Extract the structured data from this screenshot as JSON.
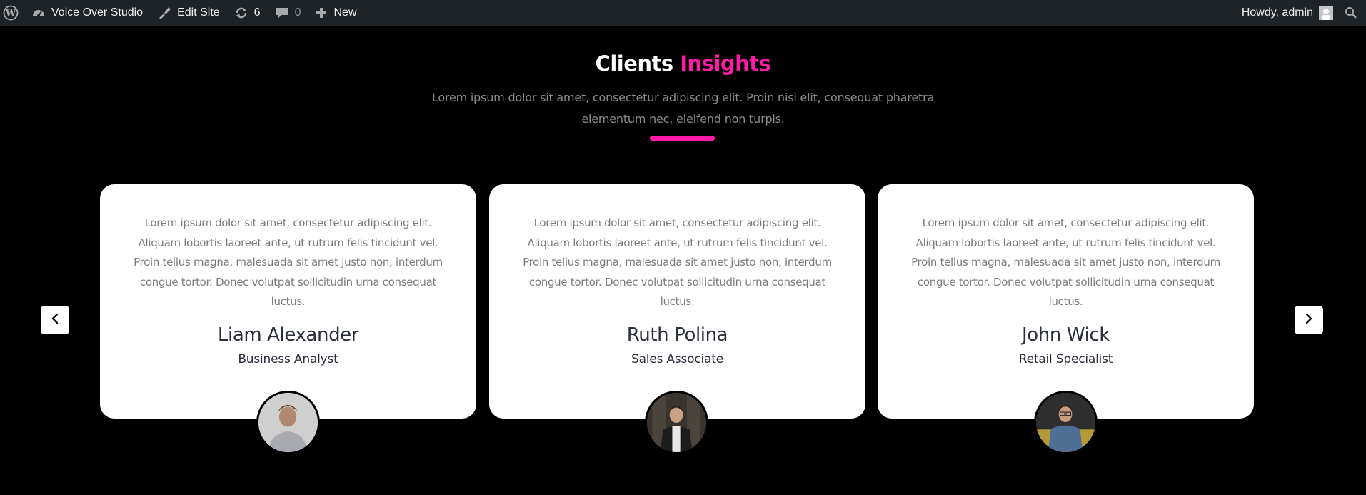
{
  "admin_bar": {
    "site_name": "Voice Over Studio",
    "edit_site": "Edit Site",
    "updates_count": "6",
    "comments_count": "0",
    "new_label": "New",
    "howdy": "Howdy, admin"
  },
  "section": {
    "title_main": "Clients",
    "title_accent": "Insights",
    "subtitle": "Lorem ipsum dolor sit amet, consectetur adipiscing elit. Proin nisi elit, consequat pharetra elementum nec, eleifend non turpis.",
    "accent_color": "#ff1aa8"
  },
  "testimonials": [
    {
      "quote": "Lorem ipsum dolor sit amet, consectetur adipiscing elit. Aliquam lobortis laoreet ante, ut rutrum felis tincidunt vel. Proin tellus magna, malesuada sit amet justo non, interdum congue tortor. Donec volutpat sollicitudin urna consequat luctus.",
      "name": "Liam Alexander",
      "role": "Business Analyst"
    },
    {
      "quote": "Lorem ipsum dolor sit amet, consectetur adipiscing elit. Aliquam lobortis laoreet ante, ut rutrum felis tincidunt vel. Proin tellus magna, malesuada sit amet justo non, interdum congue tortor. Donec volutpat sollicitudin urna consequat luctus.",
      "name": "Ruth Polina",
      "role": "Sales Associate"
    },
    {
      "quote": "Lorem ipsum dolor sit amet, consectetur adipiscing elit. Aliquam lobortis laoreet ante, ut rutrum felis tincidunt vel. Proin tellus magna, malesuada sit amet justo non, interdum congue tortor. Donec volutpat sollicitudin urna consequat luctus.",
      "name": "John Wick",
      "role": "Retail Specialist"
    }
  ],
  "icons": {
    "wordpress": "wordpress-logo-icon",
    "dashboard": "dashboard-icon",
    "edit": "paint-brush-icon",
    "updates": "refresh-icon",
    "comments": "comment-bubble-icon",
    "new": "plus-icon",
    "search": "search-icon",
    "prev": "chevron-left-icon",
    "next": "chevron-right-icon"
  }
}
